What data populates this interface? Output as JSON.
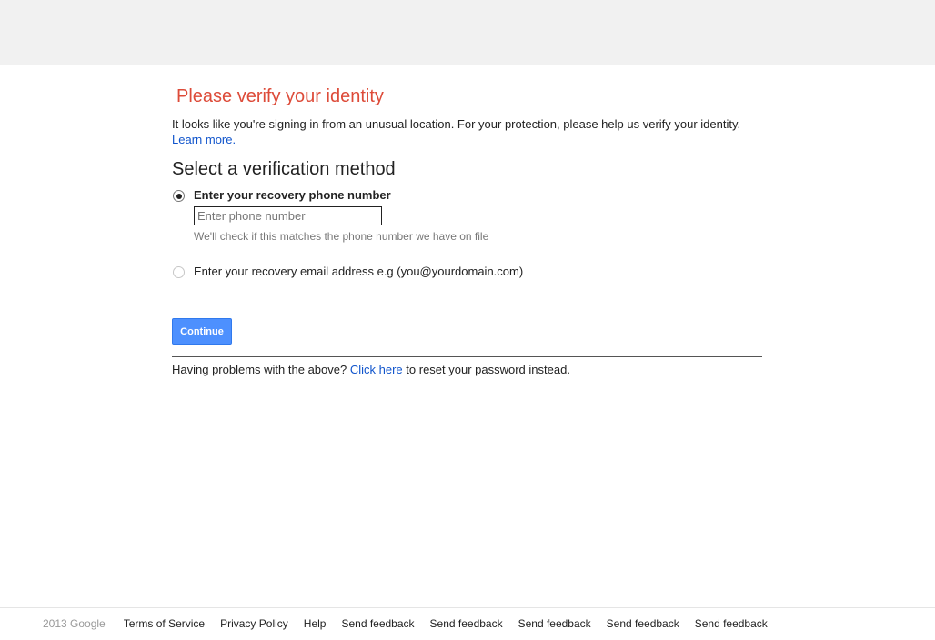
{
  "title": "Please verify your identity",
  "intro": {
    "text": "It looks like you're signing in from an unusual location. For your protection, please help us verify your identity.",
    "learn_more": "Learn more."
  },
  "subtitle": "Select a verification method",
  "options": {
    "phone": {
      "label": "Enter your recovery phone number",
      "selected": true,
      "input_value": "",
      "input_placeholder": "Enter phone number",
      "hint": "We'll check if this matches the phone number we have on file"
    },
    "email": {
      "label": "Enter your recovery email address e.g (you@yourdomain.com)",
      "selected": false
    }
  },
  "continue_label": "Continue",
  "problems": {
    "prefix": "Having problems with the above?",
    "link": "Click here",
    "suffix": "to reset your password instead."
  },
  "footer": {
    "copyright": "2013 Google",
    "links": [
      "Terms of Service",
      "Privacy Policy",
      "Help",
      "Send feedback",
      "Send feedback",
      "Send feedback",
      "Send feedback",
      "Send feedback"
    ]
  },
  "colors": {
    "title": "#dd4b39",
    "link": "#1155cc",
    "button": "#4d90fe",
    "topbar": "#f1f1f1"
  }
}
